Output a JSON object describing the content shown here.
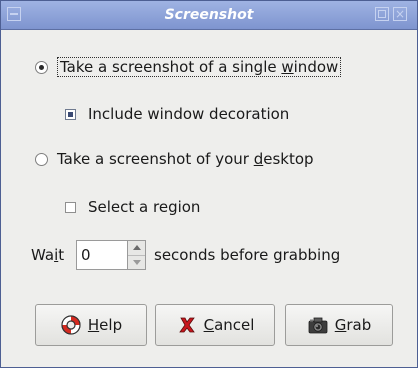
{
  "window": {
    "title": "Screenshot"
  },
  "options": {
    "single_window": {
      "label_pre": "Take a screenshot of a single ",
      "label_mnemonic": "w",
      "label_post": "indow",
      "checked": true
    },
    "include_decoration": {
      "label": "Include window decoration",
      "checked": true
    },
    "desktop": {
      "label_pre": "Take a screenshot of your ",
      "label_mnemonic": "d",
      "label_post": "esktop",
      "checked": false
    },
    "select_region": {
      "label": "Select a region",
      "checked": false
    }
  },
  "wait": {
    "label_pre": "Wa",
    "label_mnemonic": "i",
    "label_post": "t",
    "value": "0",
    "suffix": "seconds before grabbing"
  },
  "buttons": {
    "help": {
      "mnemonic": "H",
      "rest": "elp"
    },
    "cancel": {
      "mnemonic": "C",
      "rest": "ancel"
    },
    "grab": {
      "mnemonic": "G",
      "rest": "rab"
    }
  }
}
